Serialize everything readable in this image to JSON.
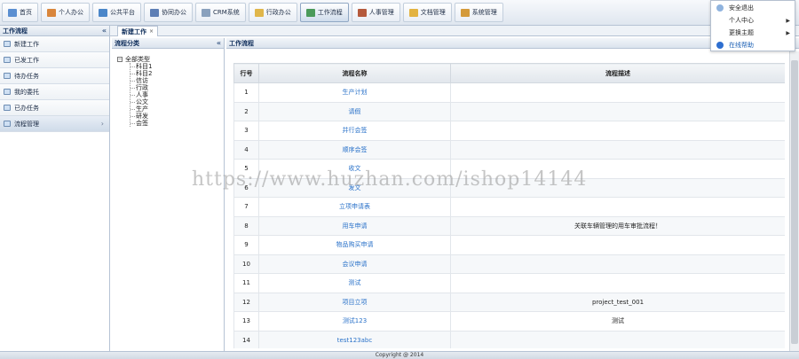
{
  "topnav": {
    "tabs": [
      {
        "label": "首页",
        "icon": "home-icon",
        "color": "#5b8fd1"
      },
      {
        "label": "个人办公",
        "icon": "user-icon",
        "color": "#d9863c"
      },
      {
        "label": "公共平台",
        "icon": "platform-icon",
        "color": "#4a86c9"
      },
      {
        "label": "协同办公",
        "icon": "people-icon",
        "color": "#5e7fb5"
      },
      {
        "label": "CRM系统",
        "icon": "crm-icon",
        "color": "#8aa1bd"
      },
      {
        "label": "行政办公",
        "icon": "folder-icon",
        "color": "#e0b64a"
      },
      {
        "label": "工作流程",
        "icon": "tools-icon",
        "color": "#4b9a5a"
      },
      {
        "label": "人事管理",
        "icon": "person-icon",
        "color": "#b55a3c"
      },
      {
        "label": "文档管理",
        "icon": "docs-icon",
        "color": "#e3b341"
      },
      {
        "label": "系统管理",
        "icon": "settings-icon",
        "color": "#d49a3a"
      }
    ],
    "active_index": 6
  },
  "dropdown": {
    "items": [
      {
        "label": "安全退出",
        "has_arrow": false,
        "icon": "exit-icon"
      },
      {
        "label": "个人中心",
        "has_arrow": true,
        "icon": ""
      },
      {
        "label": "更换主题",
        "has_arrow": true,
        "icon": ""
      },
      {
        "label": "在线帮助",
        "has_arrow": false,
        "icon": "help-icon"
      }
    ]
  },
  "sidebar": {
    "title": "工作流程",
    "collapse_glyph": "«",
    "items": [
      {
        "label": "新建工作"
      },
      {
        "label": "已发工作"
      },
      {
        "label": "待办任务"
      },
      {
        "label": "我的委托"
      },
      {
        "label": "已办任务"
      },
      {
        "label": "流程管理",
        "active": true,
        "chevron": "›"
      }
    ]
  },
  "tabstrip": {
    "active_tab": "新建工作",
    "close_glyph": "×"
  },
  "tree_pane": {
    "title": "流程分类",
    "collapse_glyph": "«",
    "root": "全部类型",
    "children": [
      "科目1",
      "科目2",
      "信访",
      "行政",
      "人事",
      "公文",
      "生产",
      "研发",
      "会签"
    ]
  },
  "main": {
    "title": "工作流程",
    "columns": [
      "行号",
      "流程名称",
      "流程描述"
    ],
    "rows": [
      {
        "no": "1",
        "name": "生产计划",
        "desc": ""
      },
      {
        "no": "2",
        "name": "请假",
        "desc": ""
      },
      {
        "no": "3",
        "name": "并行会签",
        "desc": ""
      },
      {
        "no": "4",
        "name": "顺序会签",
        "desc": ""
      },
      {
        "no": "5",
        "name": "收文",
        "desc": ""
      },
      {
        "no": "6",
        "name": "发文",
        "desc": ""
      },
      {
        "no": "7",
        "name": "立项申请表",
        "desc": ""
      },
      {
        "no": "8",
        "name": "用车申请",
        "desc": "关联车辆管理的用车审批流程！"
      },
      {
        "no": "9",
        "name": "物品购买申请",
        "desc": ""
      },
      {
        "no": "10",
        "name": "会议申请",
        "desc": ""
      },
      {
        "no": "11",
        "name": "测试",
        "desc": ""
      },
      {
        "no": "12",
        "name": "项目立项",
        "desc": "project_test_001"
      },
      {
        "no": "13",
        "name": "测试123",
        "desc": "测试"
      },
      {
        "no": "14",
        "name": "test123abc",
        "desc": ""
      }
    ]
  },
  "footer": {
    "text": "Copyright @ 2014"
  },
  "watermark": {
    "text": "https://www.huzhan.com/ishop14144"
  }
}
